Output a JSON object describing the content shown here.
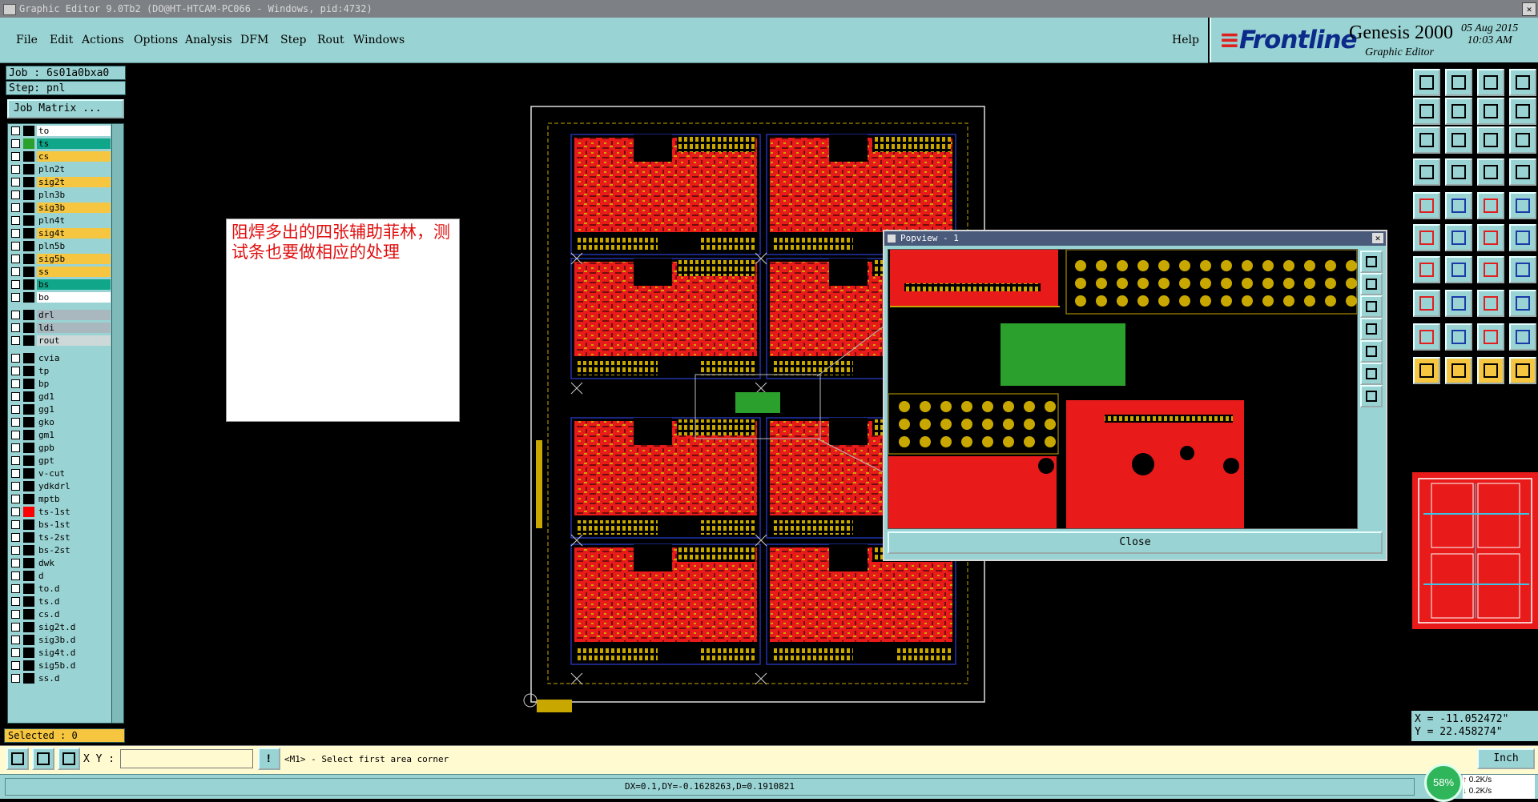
{
  "window": {
    "title": "Graphic Editor 9.0Tb2 (DO@HT-HTCAM-PC066 - Windows, pid:4732)"
  },
  "menu": [
    "File",
    "Edit",
    "Actions",
    "Options",
    "Analysis",
    "DFM",
    "Step",
    "Rout",
    "Windows"
  ],
  "help": "Help",
  "brand": {
    "logo": "Frontline",
    "product": "Genesis 2000",
    "subtitle": "Graphic Editor",
    "date": "05 Aug 2015",
    "time": "10:03 AM"
  },
  "job": {
    "job_label": "Job : 6s01a0bxa0",
    "step_label": "Step: pnl",
    "job_matrix": "Job Matrix ..."
  },
  "layers": [
    {
      "name": "to",
      "color": "#ffffff",
      "swatch": "#000000"
    },
    {
      "name": "ts",
      "color": "#0fa68a",
      "swatch": "#2ca02c"
    },
    {
      "name": "cs",
      "color": "#f6c640",
      "swatch": "#000000"
    },
    {
      "name": "pln2t",
      "color": "#9ad3d3",
      "swatch": "#000000"
    },
    {
      "name": "sig2t",
      "color": "#f6c640",
      "swatch": "#000000"
    },
    {
      "name": "pln3b",
      "color": "#9ad3d3",
      "swatch": "#000000"
    },
    {
      "name": "sig3b",
      "color": "#f6c640",
      "swatch": "#000000"
    },
    {
      "name": "pln4t",
      "color": "#9ad3d3",
      "swatch": "#000000"
    },
    {
      "name": "sig4t",
      "color": "#f6c640",
      "swatch": "#000000"
    },
    {
      "name": "pln5b",
      "color": "#9ad3d3",
      "swatch": "#000000"
    },
    {
      "name": "sig5b",
      "color": "#f6c640",
      "swatch": "#000000"
    },
    {
      "name": "ss",
      "color": "#f6c640",
      "swatch": "#000000"
    },
    {
      "name": "bs",
      "color": "#0fa68a",
      "swatch": "#000000"
    },
    {
      "name": "bo",
      "color": "#ffffff",
      "swatch": "#000000"
    },
    {
      "name": "drl",
      "color": "#a9b7be",
      "swatch": "#000000"
    },
    {
      "name": "ldi",
      "color": "#a9b7be",
      "swatch": "#000000"
    },
    {
      "name": "rout",
      "color": "#cdd9d9",
      "swatch": "#000000"
    },
    {
      "name": "cvia",
      "color": "#9ad3d3",
      "swatch": "#000000"
    },
    {
      "name": "tp",
      "color": "#9ad3d3",
      "swatch": "#000000"
    },
    {
      "name": "bp",
      "color": "#9ad3d3",
      "swatch": "#000000"
    },
    {
      "name": "gd1",
      "color": "#9ad3d3",
      "swatch": "#000000"
    },
    {
      "name": "gg1",
      "color": "#9ad3d3",
      "swatch": "#000000"
    },
    {
      "name": "gko",
      "color": "#9ad3d3",
      "swatch": "#000000"
    },
    {
      "name": "gm1",
      "color": "#9ad3d3",
      "swatch": "#000000"
    },
    {
      "name": "gpb",
      "color": "#9ad3d3",
      "swatch": "#000000"
    },
    {
      "name": "gpt",
      "color": "#9ad3d3",
      "swatch": "#000000"
    },
    {
      "name": "v-cut",
      "color": "#9ad3d3",
      "swatch": "#000000"
    },
    {
      "name": "ydkdrl",
      "color": "#9ad3d3",
      "swatch": "#000000"
    },
    {
      "name": "mptb",
      "color": "#9ad3d3",
      "swatch": "#000000"
    },
    {
      "name": "ts-1st",
      "color": "#9ad3d3",
      "swatch": "#ff0000"
    },
    {
      "name": "bs-1st",
      "color": "#9ad3d3",
      "swatch": "#000000"
    },
    {
      "name": "ts-2st",
      "color": "#9ad3d3",
      "swatch": "#000000"
    },
    {
      "name": "bs-2st",
      "color": "#9ad3d3",
      "swatch": "#000000"
    },
    {
      "name": "dwk",
      "color": "#9ad3d3",
      "swatch": "#000000"
    },
    {
      "name": "d",
      "color": "#9ad3d3",
      "swatch": "#000000"
    },
    {
      "name": "to.d",
      "color": "#9ad3d3",
      "swatch": "#000000"
    },
    {
      "name": "ts.d",
      "color": "#9ad3d3",
      "swatch": "#000000"
    },
    {
      "name": "cs.d",
      "color": "#9ad3d3",
      "swatch": "#000000"
    },
    {
      "name": "sig2t.d",
      "color": "#9ad3d3",
      "swatch": "#000000"
    },
    {
      "name": "sig3b.d",
      "color": "#9ad3d3",
      "swatch": "#000000"
    },
    {
      "name": "sig4t.d",
      "color": "#9ad3d3",
      "swatch": "#000000"
    },
    {
      "name": "sig5b.d",
      "color": "#9ad3d3",
      "swatch": "#000000"
    },
    {
      "name": "ss.d",
      "color": "#9ad3d3",
      "swatch": "#000000"
    }
  ],
  "selected": "Selected : 0",
  "note": "阻焊多出的四张辅助菲林，测试条也要做相应的处理",
  "popview": {
    "title": "Popview - 1",
    "close_label": "Close"
  },
  "coords": {
    "x": "X = -11.052472\"",
    "y": "Y = 22.458274\""
  },
  "bottom": {
    "xy_label": "X Y :",
    "xy_value": "",
    "prompt": "<M1> - Select first area corner",
    "units": "Inch"
  },
  "status": {
    "text": "DX=0.1,DY=-0.1628263,D=0.1910821",
    "net_percent": "58%",
    "up_speed": "0.2K/s",
    "down_speed": "0.2K/s"
  },
  "colors": {
    "panel": "#9ad3d3",
    "accent": "#f6c640",
    "copper": "#ff0000",
    "pad": "#c8a800"
  }
}
